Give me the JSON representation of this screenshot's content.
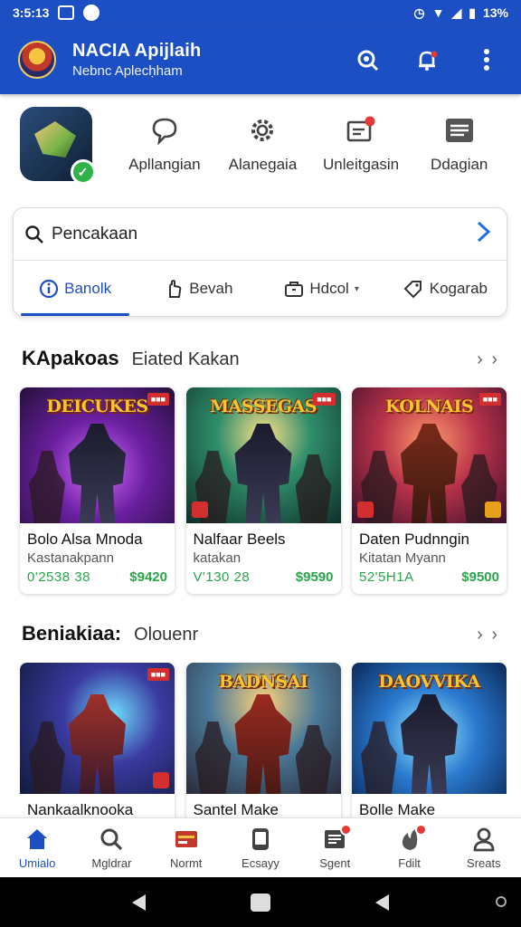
{
  "status_bar": {
    "time": "3:5:13",
    "battery": "13%"
  },
  "app_bar": {
    "title": "NACIA Apijlaih",
    "subtitle": "Nebnc Aplecḥham"
  },
  "quick_actions": [
    {
      "label": "Apllangian",
      "icon": "chat-bubble-icon"
    },
    {
      "label": "Alanegaia",
      "icon": "gear-icon"
    },
    {
      "label": "Unleitgasin",
      "icon": "inbox-alert-icon"
    },
    {
      "label": "Ddagian",
      "icon": "list-icon"
    }
  ],
  "search": {
    "placeholder": "Pencakaan"
  },
  "filters": [
    {
      "label": "Banolk",
      "icon": "info-icon"
    },
    {
      "label": "Bevah",
      "icon": "hand-icon"
    },
    {
      "label": "Hdcol",
      "icon": "toolbox-icon"
    },
    {
      "label": "Kogarab",
      "icon": "tag-icon"
    }
  ],
  "section1": {
    "title": "KApakoas",
    "subtitle": "Eiated Kakan",
    "more": "› ›",
    "cards": [
      {
        "art_title": "DEICUKES",
        "name": "Bolo Alsa Mnoda",
        "sub": "Kastanakpann",
        "code": "0'2538 38",
        "price": "$9420",
        "palette": "purple"
      },
      {
        "art_title": "MASSEGAS",
        "name": "Nalfaar Beels",
        "sub": "katakan",
        "code": "V'130 28",
        "price": "$9590",
        "palette": "teal"
      },
      {
        "art_title": "KOLNAIS",
        "name": "Daten Pudnngin",
        "sub": "Kitatan Myann",
        "code": "52'5H1A",
        "price": "$9500",
        "palette": "red"
      }
    ]
  },
  "section2": {
    "title": "Beniakiaa:",
    "subtitle": "Olouenr",
    "more": "› ›",
    "cards": [
      {
        "art_title": "",
        "name": "Nankaalknooka",
        "palette": "blue"
      },
      {
        "art_title": "BADNSAI",
        "name": "Santel Make",
        "palette": "orange"
      },
      {
        "art_title": "DAOVVIKA",
        "name": "Bolle Make",
        "palette": "sky"
      }
    ]
  },
  "bottom_nav": [
    {
      "label": "Umialo",
      "icon": "home-icon",
      "active": true
    },
    {
      "label": "Mgldrar",
      "icon": "search-icon"
    },
    {
      "label": "Normt",
      "icon": "card-icon"
    },
    {
      "label": "Ecsayy",
      "icon": "phone-icon"
    },
    {
      "label": "Sgent",
      "icon": "news-icon"
    },
    {
      "label": "Fdilt",
      "icon": "flame-icon"
    },
    {
      "label": "Sreats",
      "icon": "person-icon"
    }
  ],
  "colors": {
    "primary": "#1d4fc4",
    "price_green": "#2aa54a",
    "badge_red": "#d32f2f"
  }
}
